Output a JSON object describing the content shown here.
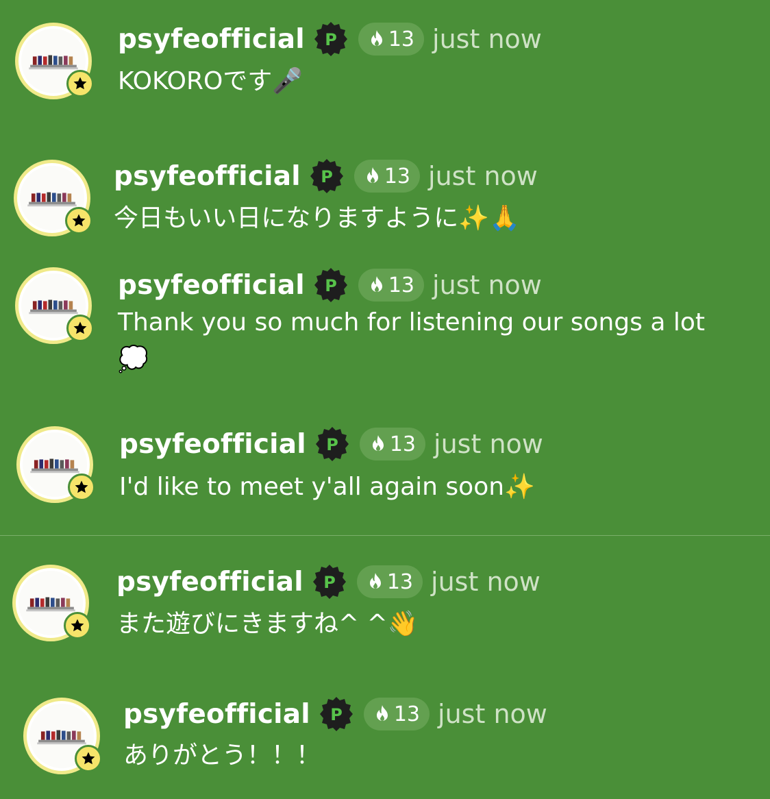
{
  "user": {
    "name": "psyfeofficial",
    "badge_letter": "P",
    "streak": "13",
    "timestamp": "just now"
  },
  "colors": {
    "background": "#4a8f38",
    "avatar_ring": "#f0ea8a",
    "star_badge": "#f6e46a",
    "p_badge_bg": "#1e1e1e",
    "p_badge_fg": "#57c24a",
    "pill_bg": "#63a050",
    "timestamp": "#cfe2c6"
  },
  "icons": {
    "avatar": "group-photo-avatar",
    "verified": "star-icon",
    "badge": "p-badge-icon",
    "streak": "flame-icon"
  },
  "messages": [
    {
      "text": "KOKOROです🎤"
    },
    {
      "text": "今日もいい日になりますように✨🙏"
    },
    {
      "text": "Thank you so much for listening our songs a lot\n💭"
    },
    {
      "text": "I'd like to meet y'all again soon✨"
    },
    {
      "text": "また遊びにきますね^ ^👋"
    },
    {
      "text": "ありがとう！！！"
    }
  ]
}
